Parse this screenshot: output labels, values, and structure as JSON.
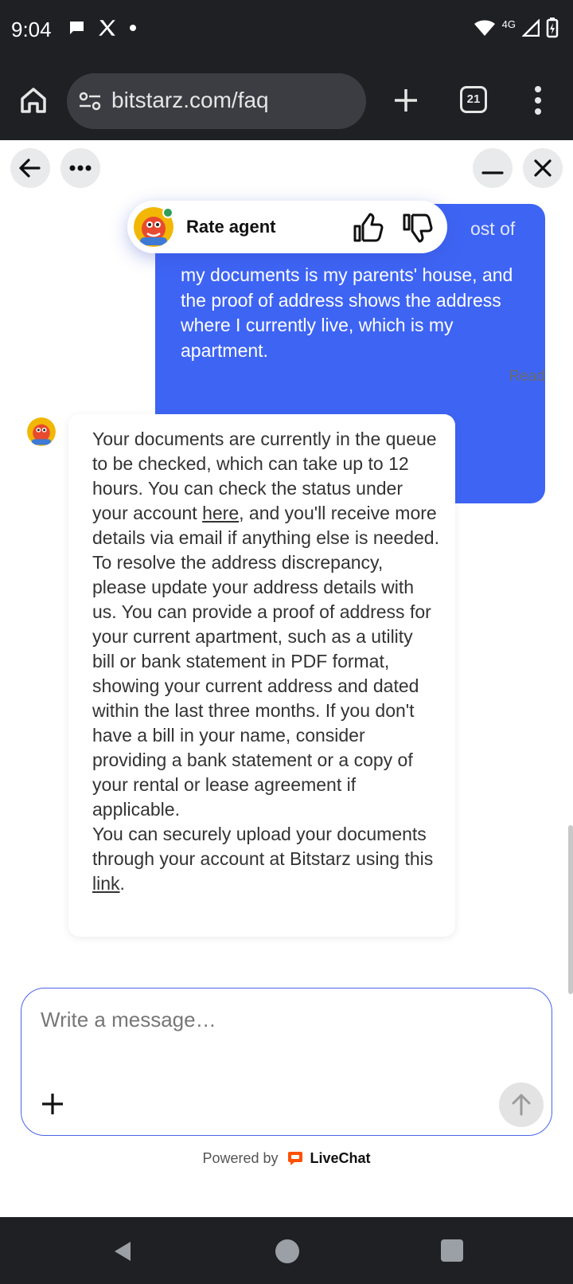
{
  "status_bar": {
    "time": "9:04",
    "network": "4G",
    "icons": [
      "chat-bubble-icon",
      "x-logo-icon",
      "dot-icon",
      "wifi-icon",
      "signal-icon",
      "battery-charging-icon"
    ]
  },
  "browser": {
    "url": "bitstarz.com/faq",
    "tab_count": "21"
  },
  "chat": {
    "rate_label": "Rate agent",
    "user_message": {
      "partial_top": "ost of",
      "text": "my documents is my parents' house, and the proof of address shows the address where I currently live, which is my apartment.",
      "status": "Read"
    },
    "agent_message": {
      "p1_before": "Your documents are currently in the queue to be checked, which can take up to 12 hours. You can check the status under your account ",
      "p1_link": "here",
      "p1_after": ", and you'll receive more details via email if anything else is needed.",
      "p2": "To resolve the address discrepancy, please update your address details with us. You can provide a proof of address for your current apartment, such as a utility bill or bank statement in PDF format, showing your current address and dated within the last three months. If you don't have a bill in your name, consider providing a bank statement or a copy of your rental or lease agreement if applicable.",
      "p3_before": "You can securely upload your documents through your account at Bitstarz using this ",
      "p3_link": "link",
      "p3_after": "."
    },
    "composer_placeholder": "Write a message…",
    "powered_prefix": "Powered by",
    "powered_brand": "LiveChat"
  },
  "colors": {
    "user_bubble": "#3e64f4",
    "composer_border": "#4a63e8",
    "livechat_orange": "#ff5100",
    "online": "#2e9e5b"
  }
}
